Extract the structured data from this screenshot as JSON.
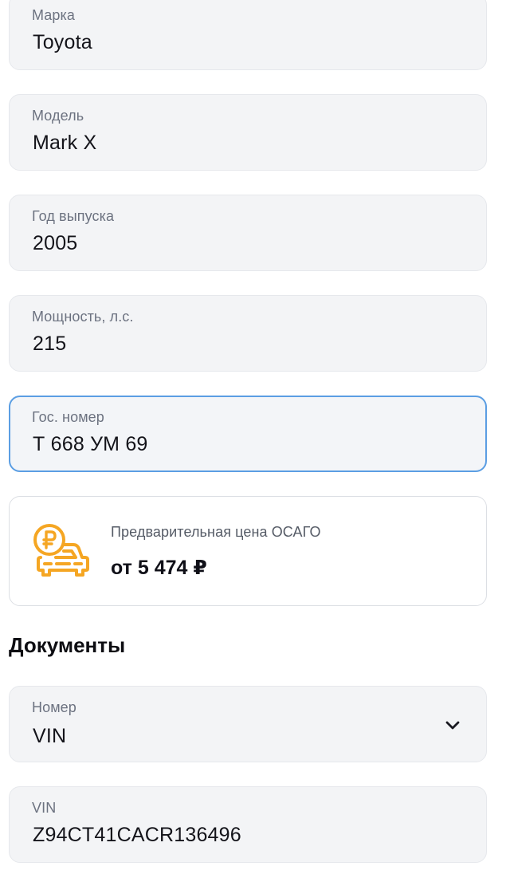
{
  "fields": {
    "brand": {
      "label": "Марка",
      "value": "Toyota"
    },
    "model": {
      "label": "Модель",
      "value": "Mark X"
    },
    "year": {
      "label": "Год выпуска",
      "value": "2005"
    },
    "power": {
      "label": "Мощность, л.с.",
      "value": "215"
    },
    "plate": {
      "label": "Гос. номер",
      "value": "Т 668 УМ 69"
    }
  },
  "price_card": {
    "label": "Предварительная цена ОСАГО",
    "value": "от 5 474 ₽",
    "icon": "car-ruble-icon",
    "icon_color": "#f5a623"
  },
  "documents": {
    "title": "Документы",
    "doc_type": {
      "label": "Номер",
      "value": "VIN",
      "icon": "chevron-down-icon"
    },
    "vin": {
      "label": "VIN",
      "value": "Z94CT41CACR136496"
    }
  },
  "colors": {
    "field_bg": "#f3f4f6",
    "focus_border": "#5b9ee3",
    "label_text": "#6c7280"
  }
}
